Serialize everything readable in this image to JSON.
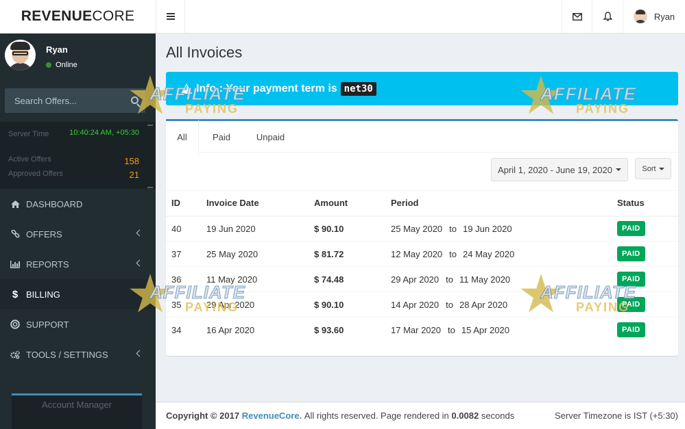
{
  "brand": {
    "logo_bold": "REVENUE",
    "logo_rest": "CORE"
  },
  "topbar": {
    "user_name": "Ryan"
  },
  "sidebar": {
    "user_name": "Ryan",
    "status": "Online",
    "search_placeholder": "Search Offers...",
    "server_time_label": "Server Time",
    "server_time_value": "10:40:24 AM, +05:30",
    "active_offers_label": "Active Offers",
    "active_offers_value": "158",
    "approved_offers_label": "Approved Offers",
    "approved_offers_value": "21",
    "menu": [
      {
        "label": "DASHBOARD",
        "icon": "home-icon"
      },
      {
        "label": "OFFERS",
        "icon": "link-icon"
      },
      {
        "label": "REPORTS",
        "icon": "bar-chart-icon"
      },
      {
        "label": "BILLING",
        "icon": "dollar-icon"
      },
      {
        "label": "SUPPORT",
        "icon": "life-ring-icon"
      },
      {
        "label": "TOOLS / SETTINGS",
        "icon": "cogs-icon"
      }
    ],
    "account_manager_label": "Account Manager"
  },
  "page": {
    "title": "All Invoices",
    "alert_text": "Info : Your payment term is",
    "alert_code": "net30"
  },
  "tabs": [
    "All",
    "Paid",
    "Unpaid"
  ],
  "filters": {
    "date_range": "April 1, 2020 - June 19, 2020",
    "sort_label": "Sort"
  },
  "table": {
    "headers": {
      "id": "ID",
      "date": "Invoice Date",
      "amount": "Amount",
      "period": "Period",
      "status": "Status"
    },
    "to_word": "to",
    "rows": [
      {
        "id": "40",
        "date": "19 Jun 2020",
        "amount": "$ 90.10",
        "from": "25 May 2020",
        "to": "19 Jun 2020",
        "status": "PAID"
      },
      {
        "id": "37",
        "date": "25 May 2020",
        "amount": "$ 81.72",
        "from": "12 May 2020",
        "to": "24 May 2020",
        "status": "PAID"
      },
      {
        "id": "36",
        "date": "11 May 2020",
        "amount": "$ 74.48",
        "from": "29 Apr 2020",
        "to": "11 May 2020",
        "status": "PAID"
      },
      {
        "id": "35",
        "date": "29 Apr 2020",
        "amount": "$ 90.10",
        "from": "14 Apr 2020",
        "to": "28 Apr 2020",
        "status": "PAID"
      },
      {
        "id": "34",
        "date": "16 Apr 2020",
        "amount": "$ 93.60",
        "from": "17 Mar 2020",
        "to": "15 Apr 2020",
        "status": "PAID"
      }
    ]
  },
  "footer": {
    "copyright": "Copyright © 2017",
    "brand": "RevenueCore.",
    "rights": "All rights reserved. Page rendered in",
    "time": "0.0082",
    "seconds": "seconds",
    "timezone": "Server Timezone is IST (+5:30)"
  },
  "watermark": {
    "line1": "AFFILIATE",
    "line2": "PAYING"
  },
  "colors": {
    "sidebar": "#222d32",
    "accent": "#3c8dbc",
    "info": "#00c0ef",
    "success": "#00a65a",
    "warning": "#f39c12"
  }
}
